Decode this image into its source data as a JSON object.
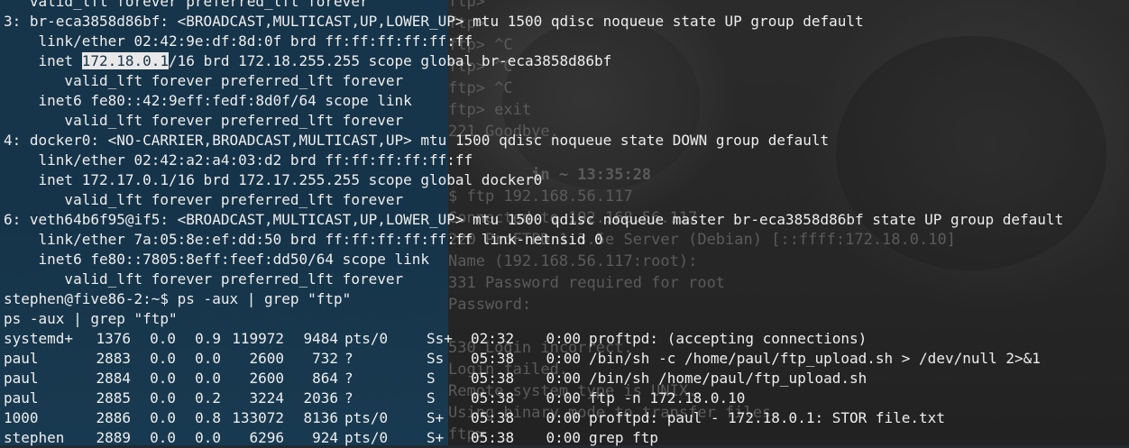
{
  "terminal": {
    "ip_lines": [
      {
        "id": "iface3-lft-top",
        "segments": [
          "   valid_lft forever preferred_lft forever"
        ]
      },
      {
        "id": "iface3-header",
        "segments": [
          "3: br-eca3858d86bf: <BROADCAST,MULTICAST,UP,LOWER_UP> mtu 1500 qdisc noqueue state UP group default"
        ]
      },
      {
        "id": "iface3-link",
        "segments": [
          "    link/ether 02:42:9e:df:8d:0f brd ff:ff:ff:ff:ff:ff"
        ]
      },
      {
        "id": "iface3-inet",
        "segments": [
          "    inet ",
          "172.18.0.1",
          "/16 brd 172.18.255.255 scope global br-eca3858d86bf"
        ]
      },
      {
        "id": "iface3-inet-lft",
        "segments": [
          "       valid_lft forever preferred_lft forever"
        ]
      },
      {
        "id": "iface3-inet6",
        "segments": [
          "    inet6 fe80::42:9eff:fedf:8d0f/64 scope link"
        ]
      },
      {
        "id": "iface3-inet6-lft",
        "segments": [
          "       valid_lft forever preferred_lft forever"
        ]
      },
      {
        "id": "iface4-header",
        "segments": [
          "4: docker0: <NO-CARRIER,BROADCAST,MULTICAST,UP> mtu 1500 qdisc noqueue state DOWN group default"
        ]
      },
      {
        "id": "iface4-link",
        "segments": [
          "    link/ether 02:42:a2:a4:03:d2 brd ff:ff:ff:ff:ff:ff"
        ]
      },
      {
        "id": "iface4-inet",
        "segments": [
          "    inet 172.17.0.1/16 brd 172.17.255.255 scope global docker0"
        ]
      },
      {
        "id": "iface4-inet-lft",
        "segments": [
          "       valid_lft forever preferred_lft forever"
        ]
      },
      {
        "id": "iface6-header",
        "segments": [
          "6: veth64b6f95@if5: <BROADCAST,MULTICAST,UP,LOWER_UP> mtu 1500 qdisc noqueue master br-eca3858d86bf state UP group default"
        ]
      },
      {
        "id": "iface6-link",
        "segments": [
          "    link/ether 7a:05:8e:ef:dd:50 brd ff:ff:ff:ff:ff:ff link-netnsid 0"
        ]
      },
      {
        "id": "iface6-inet6",
        "segments": [
          "    inet6 fe80::7805:8eff:feef:dd50/64 scope link"
        ]
      },
      {
        "id": "iface6-inet6-lft",
        "segments": [
          "       valid_lft forever preferred_lft forever"
        ]
      },
      {
        "id": "prompt",
        "segments": [
          "stephen@five86-2:~$ ps -aux | grep \"ftp\""
        ]
      },
      {
        "id": "echo",
        "segments": [
          "ps -aux | grep \"ftp\""
        ]
      }
    ],
    "ps_rows": [
      {
        "user": "systemd+",
        "pid": "1376",
        "cpu": "0.0",
        "mem": "0.9",
        "vsz": "119972",
        "rss": "9484",
        "tty": "pts/0",
        "stat": "Ss+",
        "start": "02:32",
        "time": "0:00",
        "command": "proftpd: (accepting connections)"
      },
      {
        "user": "paul",
        "pid": "2883",
        "cpu": "0.0",
        "mem": "0.0",
        "vsz": "2600",
        "rss": "732",
        "tty": "?",
        "stat": "Ss",
        "start": "05:38",
        "time": "0:00",
        "command": "/bin/sh -c /home/paul/ftp_upload.sh > /dev/null 2>&1"
      },
      {
        "user": "paul",
        "pid": "2884",
        "cpu": "0.0",
        "mem": "0.0",
        "vsz": "2600",
        "rss": "864",
        "tty": "?",
        "stat": "S",
        "start": "05:38",
        "time": "0:00",
        "command": "/bin/sh /home/paul/ftp_upload.sh"
      },
      {
        "user": "paul",
        "pid": "2885",
        "cpu": "0.0",
        "mem": "0.2",
        "vsz": "3224",
        "rss": "2036",
        "tty": "?",
        "stat": "S",
        "start": "05:38",
        "time": "0:00",
        "command": "ftp -n 172.18.0.10"
      },
      {
        "user": "1000",
        "pid": "2886",
        "cpu": "0.0",
        "mem": "0.8",
        "vsz": "133072",
        "rss": "8136",
        "tty": "pts/0",
        "stat": "S+",
        "start": "05:38",
        "time": "0:00",
        "command": "proftpd: paul - 172.18.0.1: STOR file.txt"
      },
      {
        "user": "stephen",
        "pid": "2889",
        "cpu": "0.0",
        "mem": "0.0",
        "vsz": "6296",
        "rss": "924",
        "tty": "pts/0",
        "stat": "S+",
        "start": "05:38",
        "time": "0:00",
        "command": "grep ftp"
      }
    ]
  },
  "background_terminal": {
    "lines": [
      "ftp>",
      "ftp>",
      "ftp> ^C",
      "ftp> ^C",
      "ftp> ^C",
      "ftp> exit",
      "221 Goodbye.",
      "",
      "         in ~ 13:35:28",
      "$ ftp 192.168.56.117",
      "Connected to 192.168.56.117.",
      "220 ProFTPD 1.3.5e Server (Debian) [::ffff:172.18.0.10]",
      "Name (192.168.56.117:root):",
      "331 Password required for root",
      "Password:",
      "",
      "530 Login incorrect.",
      "Login failed.",
      "Remote system type is UNIX.",
      "Using binary mode to transfer files.",
      "ftp>"
    ]
  },
  "colors": {
    "terminal_bg": "#16344a",
    "text": "#eeeeee",
    "highlight_bg": "#e8e8e8",
    "background_text": "#5b5b5b"
  }
}
